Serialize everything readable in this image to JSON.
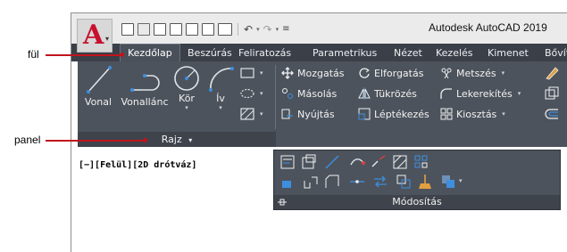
{
  "window": {
    "title": "Autodesk AutoCAD 2019"
  },
  "app_button": {
    "letter": "A",
    "caret": "▾"
  },
  "qat": {
    "caret": "▾"
  },
  "tabs": [
    "Kezdőlap",
    "Beszúrás",
    "Feliratozás",
    "Parametrikus",
    "Nézet",
    "Kezelés",
    "Kimenet",
    "Bővít"
  ],
  "draw_panel": {
    "tools": [
      "Vonal",
      "Vonallánc",
      "Kör",
      "Ív"
    ],
    "caret": "▾",
    "title": "Rajz",
    "title_caret": "▾"
  },
  "modify_panel": {
    "rows": [
      [
        "Mozgatás",
        "Elforgatás",
        "Metszés"
      ],
      [
        "Másolás",
        "Tükrözés",
        "Lekerekítés"
      ],
      [
        "Nyújtás",
        "Léptékezés",
        "Kiosztás"
      ]
    ],
    "caret": "▾",
    "title": "Módosítás"
  },
  "viewport": {
    "label": "[−][Felül][2D drótváz]"
  },
  "callouts": {
    "tab": "fül",
    "panel": "panel"
  },
  "colors": {
    "ribbon": "#4d535c",
    "tabbar": "#3a3f48",
    "accent": "#c0141c"
  }
}
